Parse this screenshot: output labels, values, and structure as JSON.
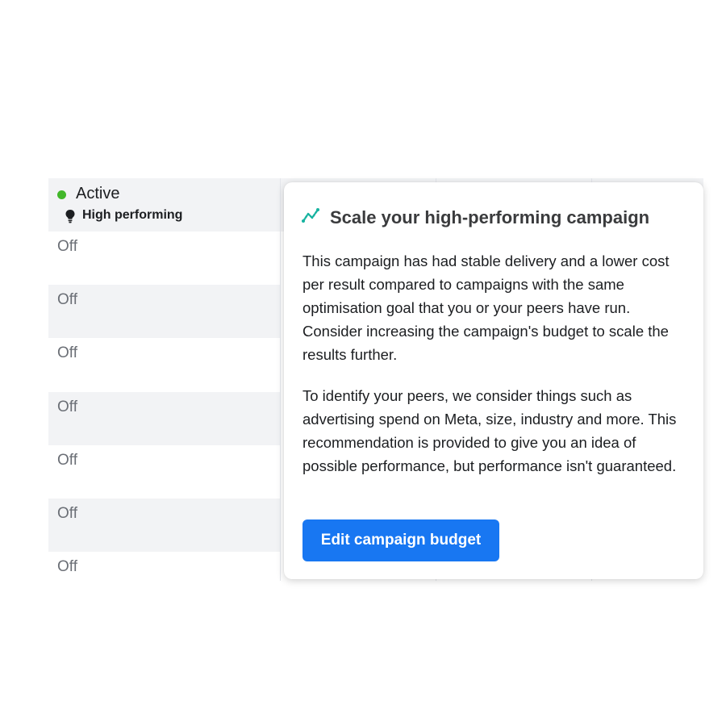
{
  "table": {
    "active_row": {
      "status": "Active",
      "status_color": "#42b72a",
      "badge_icon": "lightbulb-icon",
      "badge": "High performing"
    },
    "rows": [
      {
        "status": "Off"
      },
      {
        "status": "Off"
      },
      {
        "status": "Off"
      },
      {
        "status": "Off"
      },
      {
        "status": "Off"
      },
      {
        "status": "Off"
      },
      {
        "status": "Off"
      }
    ]
  },
  "popover": {
    "icon": "trend-up-icon",
    "title": "Scale your high-performing campaign",
    "paragraph1": "This campaign has had stable delivery and a lower cost per result compared to campaigns with the same optimisation goal that you or your peers have run. Consider increasing the campaign's budget to scale the results further.",
    "paragraph2": "To identify your peers, we consider things such as advertising spend on Meta, size, industry and more. This recommendation is provided to give you an idea of possible performance, but performance isn't guaranteed.",
    "button_label": "Edit campaign budget",
    "accent": "#1877f2"
  }
}
